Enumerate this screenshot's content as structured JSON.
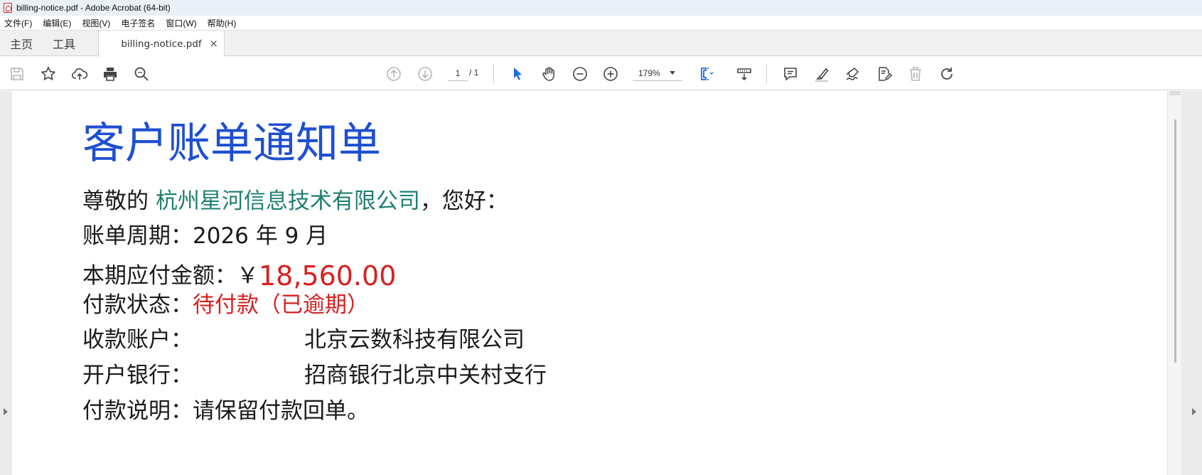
{
  "window": {
    "title": "billing-notice.pdf - Adobe Acrobat (64-bit)"
  },
  "menu": {
    "items": [
      {
        "label": "文件(F)"
      },
      {
        "label": "编辑(E)"
      },
      {
        "label": "视图(V)"
      },
      {
        "label": "电子签名"
      },
      {
        "label": "窗口(W)"
      },
      {
        "label": "帮助(H)"
      }
    ]
  },
  "tabs": {
    "home": "主页",
    "tools": "工具",
    "document": "billing-notice.pdf",
    "close": "×"
  },
  "toolbar": {
    "current_page": "1",
    "page_total": "/ 1",
    "zoom": "179%",
    "icons": [
      "save-icon",
      "bookmark-star-icon",
      "cloud-upload-icon",
      "print-icon",
      "find-icon",
      "page-up-icon",
      "page-down-icon",
      "select-arrow-icon",
      "hand-icon",
      "zoom-out-icon",
      "zoom-in-icon",
      "fit-page-icon",
      "scroll-mode-icon",
      "comment-icon",
      "highlight-icon",
      "sign-icon",
      "edit-pdf-icon",
      "delete-icon",
      "rotate-icon"
    ]
  },
  "document": {
    "title": "客户账单通知单",
    "greeting_prefix": "尊敬的 ",
    "company": "杭州星河信息技术有限公司",
    "greeting_suffix": "，您好：",
    "period_label": "账单周期：",
    "period_value": "2026 年 9 月",
    "amount_label": "本期应付金额：￥",
    "amount_value": "18,560.00",
    "status_label": "付款状态：",
    "status_value": "待付款（已逾期）",
    "payee_label": "收款账户：",
    "payee_value": "北京云数科技有限公司",
    "bank_label": "开户银行：",
    "bank_value": "招商银行北京中关村支行",
    "note_label": "付款说明：",
    "note_value": "请保留付款回单。"
  },
  "colors": {
    "title": "#1f4fd1",
    "company": "#1f7f72",
    "alert": "#d71f1f",
    "accent_blue": "#1e6fd9"
  }
}
